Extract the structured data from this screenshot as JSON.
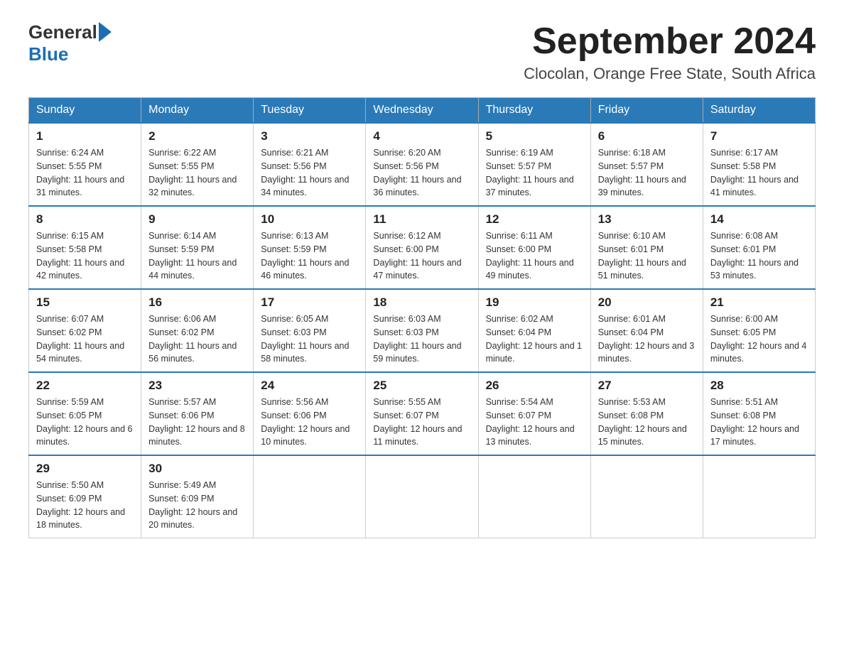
{
  "header": {
    "logo_general": "General",
    "logo_blue": "Blue",
    "month_title": "September 2024",
    "location": "Clocolan, Orange Free State, South Africa"
  },
  "weekdays": [
    "Sunday",
    "Monday",
    "Tuesday",
    "Wednesday",
    "Thursday",
    "Friday",
    "Saturday"
  ],
  "weeks": [
    [
      {
        "day": "1",
        "sunrise": "6:24 AM",
        "sunset": "5:55 PM",
        "daylight": "11 hours and 31 minutes."
      },
      {
        "day": "2",
        "sunrise": "6:22 AM",
        "sunset": "5:55 PM",
        "daylight": "11 hours and 32 minutes."
      },
      {
        "day": "3",
        "sunrise": "6:21 AM",
        "sunset": "5:56 PM",
        "daylight": "11 hours and 34 minutes."
      },
      {
        "day": "4",
        "sunrise": "6:20 AM",
        "sunset": "5:56 PM",
        "daylight": "11 hours and 36 minutes."
      },
      {
        "day": "5",
        "sunrise": "6:19 AM",
        "sunset": "5:57 PM",
        "daylight": "11 hours and 37 minutes."
      },
      {
        "day": "6",
        "sunrise": "6:18 AM",
        "sunset": "5:57 PM",
        "daylight": "11 hours and 39 minutes."
      },
      {
        "day": "7",
        "sunrise": "6:17 AM",
        "sunset": "5:58 PM",
        "daylight": "11 hours and 41 minutes."
      }
    ],
    [
      {
        "day": "8",
        "sunrise": "6:15 AM",
        "sunset": "5:58 PM",
        "daylight": "11 hours and 42 minutes."
      },
      {
        "day": "9",
        "sunrise": "6:14 AM",
        "sunset": "5:59 PM",
        "daylight": "11 hours and 44 minutes."
      },
      {
        "day": "10",
        "sunrise": "6:13 AM",
        "sunset": "5:59 PM",
        "daylight": "11 hours and 46 minutes."
      },
      {
        "day": "11",
        "sunrise": "6:12 AM",
        "sunset": "6:00 PM",
        "daylight": "11 hours and 47 minutes."
      },
      {
        "day": "12",
        "sunrise": "6:11 AM",
        "sunset": "6:00 PM",
        "daylight": "11 hours and 49 minutes."
      },
      {
        "day": "13",
        "sunrise": "6:10 AM",
        "sunset": "6:01 PM",
        "daylight": "11 hours and 51 minutes."
      },
      {
        "day": "14",
        "sunrise": "6:08 AM",
        "sunset": "6:01 PM",
        "daylight": "11 hours and 53 minutes."
      }
    ],
    [
      {
        "day": "15",
        "sunrise": "6:07 AM",
        "sunset": "6:02 PM",
        "daylight": "11 hours and 54 minutes."
      },
      {
        "day": "16",
        "sunrise": "6:06 AM",
        "sunset": "6:02 PM",
        "daylight": "11 hours and 56 minutes."
      },
      {
        "day": "17",
        "sunrise": "6:05 AM",
        "sunset": "6:03 PM",
        "daylight": "11 hours and 58 minutes."
      },
      {
        "day": "18",
        "sunrise": "6:03 AM",
        "sunset": "6:03 PM",
        "daylight": "11 hours and 59 minutes."
      },
      {
        "day": "19",
        "sunrise": "6:02 AM",
        "sunset": "6:04 PM",
        "daylight": "12 hours and 1 minute."
      },
      {
        "day": "20",
        "sunrise": "6:01 AM",
        "sunset": "6:04 PM",
        "daylight": "12 hours and 3 minutes."
      },
      {
        "day": "21",
        "sunrise": "6:00 AM",
        "sunset": "6:05 PM",
        "daylight": "12 hours and 4 minutes."
      }
    ],
    [
      {
        "day": "22",
        "sunrise": "5:59 AM",
        "sunset": "6:05 PM",
        "daylight": "12 hours and 6 minutes."
      },
      {
        "day": "23",
        "sunrise": "5:57 AM",
        "sunset": "6:06 PM",
        "daylight": "12 hours and 8 minutes."
      },
      {
        "day": "24",
        "sunrise": "5:56 AM",
        "sunset": "6:06 PM",
        "daylight": "12 hours and 10 minutes."
      },
      {
        "day": "25",
        "sunrise": "5:55 AM",
        "sunset": "6:07 PM",
        "daylight": "12 hours and 11 minutes."
      },
      {
        "day": "26",
        "sunrise": "5:54 AM",
        "sunset": "6:07 PM",
        "daylight": "12 hours and 13 minutes."
      },
      {
        "day": "27",
        "sunrise": "5:53 AM",
        "sunset": "6:08 PM",
        "daylight": "12 hours and 15 minutes."
      },
      {
        "day": "28",
        "sunrise": "5:51 AM",
        "sunset": "6:08 PM",
        "daylight": "12 hours and 17 minutes."
      }
    ],
    [
      {
        "day": "29",
        "sunrise": "5:50 AM",
        "sunset": "6:09 PM",
        "daylight": "12 hours and 18 minutes."
      },
      {
        "day": "30",
        "sunrise": "5:49 AM",
        "sunset": "6:09 PM",
        "daylight": "12 hours and 20 minutes."
      },
      null,
      null,
      null,
      null,
      null
    ]
  ],
  "labels": {
    "sunrise": "Sunrise:",
    "sunset": "Sunset:",
    "daylight": "Daylight:"
  }
}
